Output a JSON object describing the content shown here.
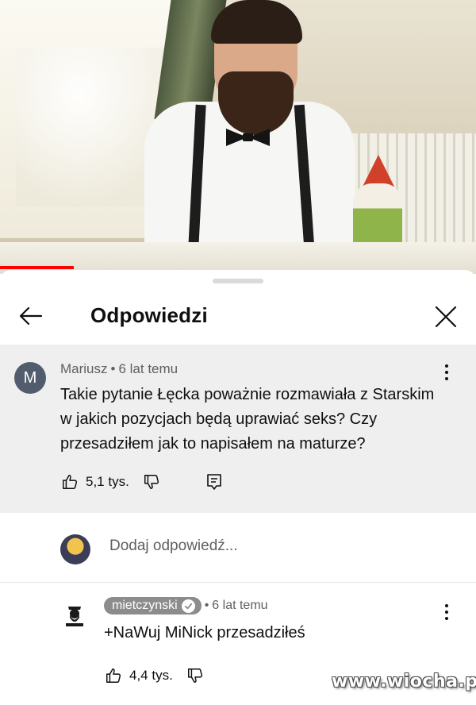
{
  "sheet": {
    "title": "Odpowiedzi"
  },
  "top_comment": {
    "avatar_letter": "M",
    "author": "Mariusz",
    "separator": "•",
    "time": "6 lat temu",
    "text": "Takie pytanie Łęcka poważnie rozmawiała z Starskim w jakich pozycjach będą uprawiać seks? Czy przesadziłem jak to napisałem na maturze?",
    "likes": "5,1 tys."
  },
  "add_reply": {
    "placeholder": "Dodaj odpowiedź..."
  },
  "reply": {
    "author": "mietczynski",
    "separator": "•",
    "time": "6 lat temu",
    "text": "+NaWuj MiNick przesadziłeś",
    "likes": "4,4 tys."
  },
  "watermark": "www.wiocha.pl",
  "colors": {
    "progress": "#ff0000",
    "comment_bg": "#efefef",
    "author_chip": "#8c8c8c",
    "avatar_m": "#515d6e"
  },
  "icons": [
    "back-arrow-icon",
    "close-icon",
    "more-vert-icon",
    "thumbs-up-icon",
    "thumbs-down-icon",
    "reply-icon",
    "verified-check-icon"
  ],
  "video": {
    "progress_fraction": 0.155
  }
}
